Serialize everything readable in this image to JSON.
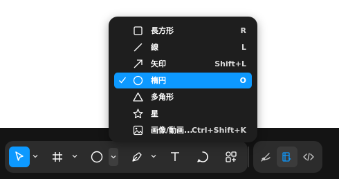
{
  "menu": {
    "items": [
      {
        "label": "長方形",
        "shortcut": "R",
        "icon": "rectangle-icon",
        "selected": false
      },
      {
        "label": "線",
        "shortcut": "L",
        "icon": "line-icon",
        "selected": false
      },
      {
        "label": "矢印",
        "shortcut": "Shift+L",
        "icon": "arrow-icon",
        "selected": false
      },
      {
        "label": "楕円",
        "shortcut": "O",
        "icon": "ellipse-icon",
        "selected": true
      },
      {
        "label": "多角形",
        "shortcut": "",
        "icon": "polygon-icon",
        "selected": false
      },
      {
        "label": "星",
        "shortcut": "",
        "icon": "star-icon",
        "selected": false
      },
      {
        "label": "画像/動画...",
        "shortcut": "Ctrl+Shift+K",
        "icon": "image-icon",
        "selected": false
      }
    ]
  },
  "toolbar": {
    "tools": [
      "move-tool",
      "frame-tool",
      "shape-tool",
      "pen-tool",
      "text-tool",
      "comment-tool",
      "actions-tool"
    ],
    "modes": [
      "draw-mode",
      "design-mode",
      "dev-mode"
    ],
    "accent": "#0d99ff",
    "background": "#2c2c2c"
  }
}
